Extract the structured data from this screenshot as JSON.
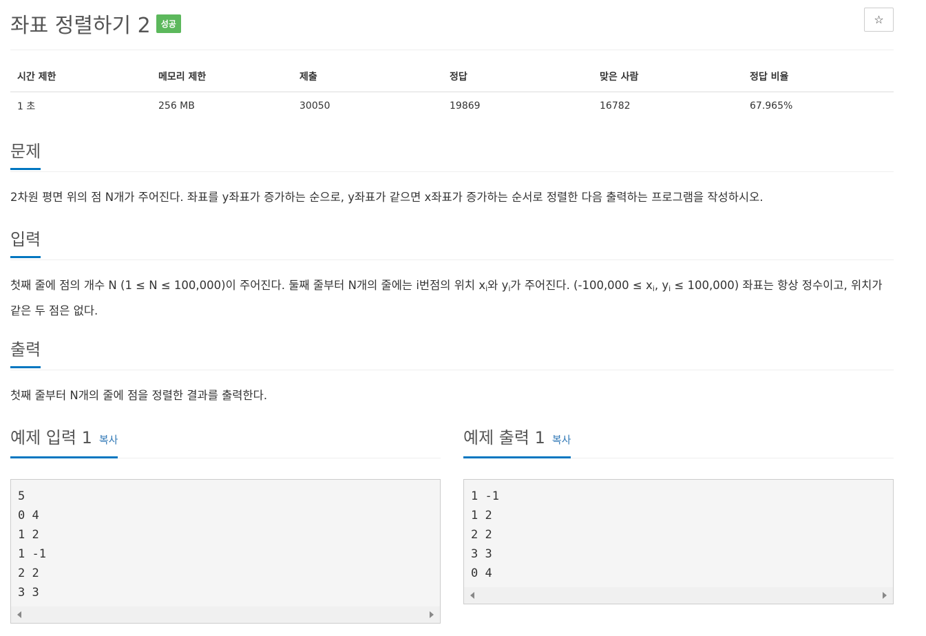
{
  "problem": {
    "title": "좌표 정렬하기 2",
    "badge": "성공",
    "star_icon": "☆"
  },
  "info": {
    "headers": [
      "시간 제한",
      "메모리 제한",
      "제출",
      "정답",
      "맞은 사람",
      "정답 비율"
    ],
    "values": [
      "1 초",
      "256 MB",
      "30050",
      "19869",
      "16782",
      "67.965%"
    ]
  },
  "sections": {
    "problem_heading": "문제",
    "problem_text": "2차원 평면 위의 점 N개가 주어진다. 좌표를 y좌표가 증가하는 순으로, y좌표가 같으면 x좌표가 증가하는 순서로 정렬한 다음 출력하는 프로그램을 작성하시오.",
    "input_heading": "입력",
    "input_text_1": "첫째 줄에 점의 개수 N (1 ≤ N ≤ 100,000)이 주어진다. 둘째 줄부터 N개의 줄에는 i번점의 위치 x",
    "input_sub_i": "i",
    "input_text_2": "와 y",
    "input_text_3": "가 주어진다. (-100,000 ≤ x",
    "input_text_4": ", y",
    "input_text_5": " ≤ 100,000) 좌표는 항상 정수이고, 위치가 같은 두 점은 없다.",
    "output_heading": "출력",
    "output_text": "첫째 줄부터 N개의 줄에 점을 정렬한 결과를 출력한다."
  },
  "samples": {
    "input_heading": "예제 입력 1",
    "output_heading": "예제 출력 1",
    "copy_label": "복사",
    "input_lines": [
      "5",
      "0 4",
      "1 2",
      "1 -1",
      "2 2",
      "3 3"
    ],
    "output_lines": [
      "1 -1",
      "1 2",
      "2 2",
      "3 3",
      "0 4"
    ]
  }
}
